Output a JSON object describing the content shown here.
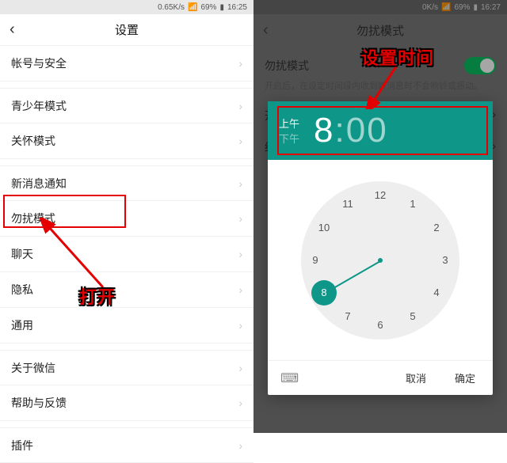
{
  "left": {
    "status": {
      "speed": "0.65K/s",
      "battery": "69%",
      "time": "16:25"
    },
    "title": "设置",
    "items": [
      {
        "label": "帐号与安全"
      },
      {
        "label": "青少年模式"
      },
      {
        "label": "关怀模式"
      },
      {
        "label": "新消息通知"
      },
      {
        "label": "勿扰模式"
      },
      {
        "label": "聊天"
      },
      {
        "label": "隐私"
      },
      {
        "label": "通用"
      },
      {
        "label": "关于微信"
      },
      {
        "label": "帮助与反馈"
      },
      {
        "label": "插件"
      }
    ],
    "annotation": "打开"
  },
  "right": {
    "status": {
      "speed": "0K/s",
      "battery": "69%",
      "time": "16:27"
    },
    "title": "勿扰模式",
    "dnd_label": "勿扰模式",
    "dnd_desc": "开启后，在设定时间段内收到新消息时不会响铃或振动。",
    "start_label": "开始时",
    "end_label": "结束时",
    "time_suffix": "00",
    "annotation": "设置时间",
    "picker": {
      "am": "上午",
      "pm": "下午",
      "hour": "8",
      "minute": "00",
      "cancel": "取消",
      "ok": "确定",
      "selected_hour": 8
    }
  },
  "clock_numbers": [
    12,
    1,
    2,
    3,
    4,
    5,
    6,
    7,
    8,
    9,
    10,
    11
  ]
}
